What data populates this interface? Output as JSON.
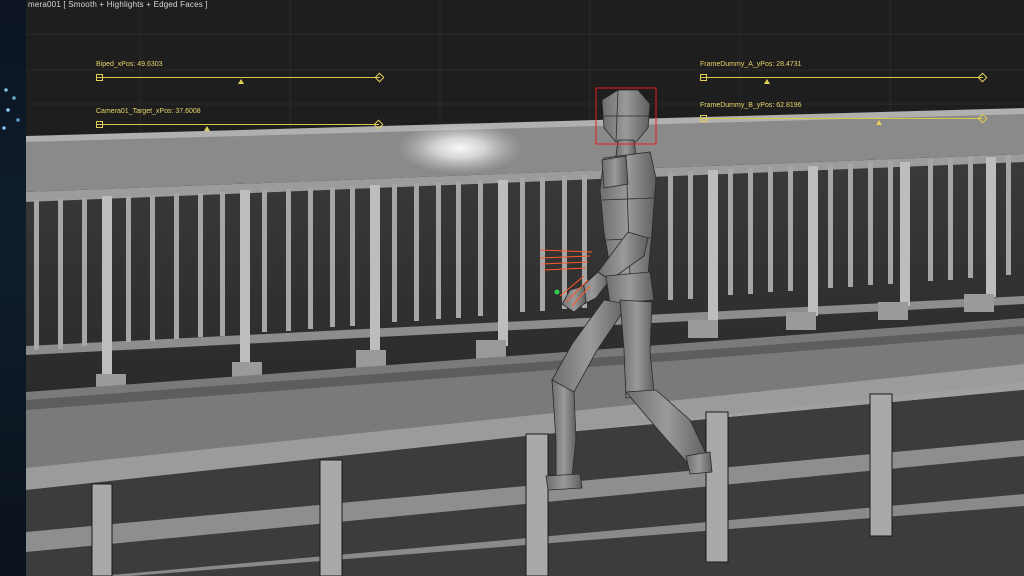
{
  "viewport": {
    "label": "mera001 [ Smooth + Highlights + Edged Faces ]"
  },
  "sliders": [
    {
      "label": "Biped_xPos: 49.6303",
      "value": 49.6303
    },
    {
      "label": "Camera01_Target_xPos: 37.6008",
      "value": 37.6008
    },
    {
      "label": "FrameDummy_A_yPos: 28.4731",
      "value": 28.4731
    },
    {
      "label": "FrameDummy_B_yPos: 62.8196",
      "value": 62.8196
    }
  ],
  "colors": {
    "slider": "#e2cf58",
    "selection": "#e02020",
    "bone": "#ff5a2a"
  }
}
